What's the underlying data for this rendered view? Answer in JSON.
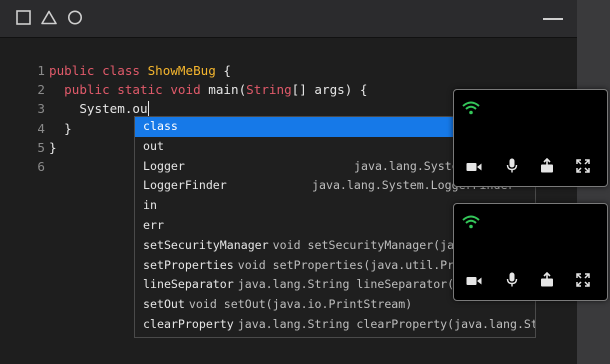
{
  "window": {
    "controls": [
      "square-icon",
      "triangle-icon",
      "circle-icon"
    ],
    "minimize_icon": "minimize-icon"
  },
  "code": {
    "lines": [
      {
        "num": "1",
        "tokens": [
          {
            "t": "public ",
            "c": "kw"
          },
          {
            "t": "class ",
            "c": "kw"
          },
          {
            "t": "ShowMeBug",
            "c": "cls"
          },
          {
            "t": " {",
            "c": "txt"
          }
        ]
      },
      {
        "num": "2",
        "tokens": [
          {
            "t": "  ",
            "c": "txt"
          },
          {
            "t": "public ",
            "c": "kw"
          },
          {
            "t": "static ",
            "c": "kw"
          },
          {
            "t": "void ",
            "c": "kw"
          },
          {
            "t": "main(",
            "c": "txt"
          },
          {
            "t": "String",
            "c": "typ"
          },
          {
            "t": "[] args) {",
            "c": "txt"
          }
        ]
      },
      {
        "num": "3",
        "tokens": [
          {
            "t": "    System.ou",
            "c": "txt"
          }
        ]
      },
      {
        "num": "4",
        "tokens": [
          {
            "t": "  }",
            "c": "txt"
          }
        ]
      },
      {
        "num": "5",
        "tokens": [
          {
            "t": "}",
            "c": "txt"
          }
        ]
      },
      {
        "num": "6",
        "tokens": []
      }
    ]
  },
  "autocomplete": {
    "items": [
      {
        "label": "class",
        "detail": "",
        "selected": true
      },
      {
        "label": "out",
        "detail": ""
      },
      {
        "label": "Logger",
        "detail": "java.lang.System.Logger",
        "align": "right"
      },
      {
        "label": "LoggerFinder",
        "detail": "java.lang.System.LoggerFinder",
        "align": "right2"
      },
      {
        "label": "in",
        "detail": ""
      },
      {
        "label": "err",
        "detail": ""
      },
      {
        "label": "setSecurityManager",
        "detail": "void setSecurityManager(java.lang.SecurityManager)"
      },
      {
        "label": "setProperties",
        "detail": "void setProperties(java.util.Properties)"
      },
      {
        "label": "lineSeparator",
        "detail": "java.lang.String lineSeparator()"
      },
      {
        "label": "setOut",
        "detail": "void setOut(java.io.PrintStream)"
      },
      {
        "label": "clearProperty",
        "detail": "java.lang.String clearProperty(java.lang.String)"
      }
    ]
  },
  "video_tiles": [
    {
      "wifi_color": "#34c759",
      "controls": [
        "camera-icon",
        "microphone-icon",
        "share-icon",
        "fullscreen-icon"
      ]
    },
    {
      "wifi_color": "#34c759",
      "controls": [
        "camera-icon",
        "microphone-icon",
        "share-icon",
        "fullscreen-icon"
      ]
    }
  ],
  "colors": {
    "keyword": "#e05a6a",
    "class_name": "#f5b62e",
    "selection": "#1679e8"
  }
}
